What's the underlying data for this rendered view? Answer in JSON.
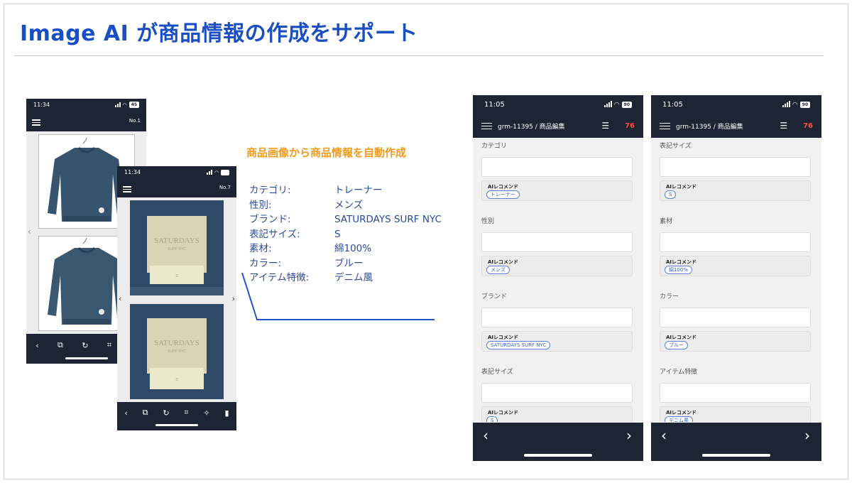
{
  "slide": {
    "title": "Image AI が商品情報の作成をサポート"
  },
  "left_phone_a": {
    "time": "11:34",
    "battery": "45",
    "photo_no": "No.1"
  },
  "left_phone_b": {
    "time": "11:34",
    "photo_no": "No.7",
    "tag_brand": "SATURDAYS",
    "tag_sub": "SURF NYC",
    "tag_size": "S"
  },
  "middle": {
    "heading": "商品画像から商品情報を自動作成",
    "attributes": [
      {
        "key": "カテゴリ:",
        "value": "トレーナー"
      },
      {
        "key": "性別:",
        "value": "メンズ"
      },
      {
        "key": "ブランド:",
        "value": "SATURDAYS SURF NYC"
      },
      {
        "key": "表記サイズ:",
        "value": "S"
      },
      {
        "key": "素材:",
        "value": "綿100%"
      },
      {
        "key": "カラー:",
        "value": "ブルー"
      },
      {
        "key": "アイテム特徴:",
        "value": "デニム風"
      }
    ]
  },
  "edit_phone_1": {
    "time": "11:05",
    "battery": "90",
    "breadcrumb": "grm-11395 / 商品編集",
    "count": "76",
    "fields": [
      {
        "label": "カテゴリ",
        "rec_label": "AIレコメンド",
        "chip": "トレーナー"
      },
      {
        "label": "性別",
        "rec_label": "AIレコメンド",
        "chip": "メンズ"
      },
      {
        "label": "ブランド",
        "rec_label": "AIレコメンド",
        "chip": "SATURDAYS SURF NYC"
      },
      {
        "label": "表記サイズ",
        "rec_label": "AIレコメンド",
        "chip": "S"
      }
    ]
  },
  "edit_phone_2": {
    "time": "11:05",
    "battery": "90",
    "breadcrumb": "grm-11395 / 商品編集",
    "count": "76",
    "fields": [
      {
        "label": "表記サイズ",
        "rec_label": "AIレコメンド",
        "chip": "S"
      },
      {
        "label": "素材",
        "rec_label": "AIレコメンド",
        "chip": "綿100%"
      },
      {
        "label": "カラー",
        "rec_label": "AIレコメンド",
        "chip": "ブルー"
      },
      {
        "label": "アイテム特徴",
        "rec_label": "AIレコメンド",
        "chip": "デニム風"
      }
    ]
  },
  "colors": {
    "title": "#1a4fc4",
    "accent_orange": "#f29a1c",
    "attribute_text": "#2a4a9c",
    "phone_dark": "#1d2433",
    "count_red": "#ff4d3a",
    "chip_blue": "#3a63c8"
  }
}
